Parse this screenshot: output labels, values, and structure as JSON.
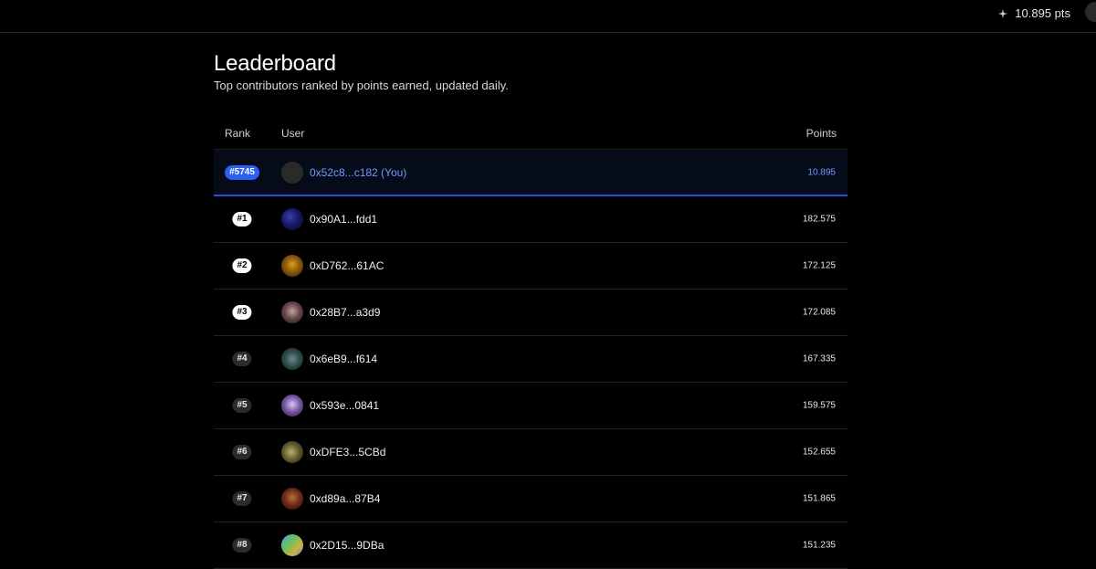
{
  "header": {
    "points_display": "10.895 pts",
    "icons": {
      "points": "sparkle-icon"
    }
  },
  "page": {
    "title": "Leaderboard",
    "subtitle": "Top contributors ranked by points earned, updated daily."
  },
  "table": {
    "columns": {
      "rank": "Rank",
      "user": "User",
      "points": "Points"
    },
    "current_user": {
      "rank": "#5745",
      "user": "0x52c8...c182 (You)",
      "points": "10.895"
    },
    "rows": [
      {
        "rank": "#1",
        "user": "0x90A1...fdd1",
        "points": "182.575"
      },
      {
        "rank": "#2",
        "user": "0xD762...61AC",
        "points": "172.125"
      },
      {
        "rank": "#3",
        "user": "0x28B7...a3d9",
        "points": "172.085"
      },
      {
        "rank": "#4",
        "user": "0x6eB9...f614",
        "points": "167.335"
      },
      {
        "rank": "#5",
        "user": "0x593e...0841",
        "points": "159.575"
      },
      {
        "rank": "#6",
        "user": "0xDFE3...5CBd",
        "points": "152.655"
      },
      {
        "rank": "#7",
        "user": "0xd89a...87B4",
        "points": "151.865"
      },
      {
        "rank": "#8",
        "user": "0x2D15...9DBa",
        "points": "151.235"
      }
    ]
  },
  "colors": {
    "background": "#000000",
    "accent": "#2d5ff2",
    "you_text": "#6f9cff"
  }
}
